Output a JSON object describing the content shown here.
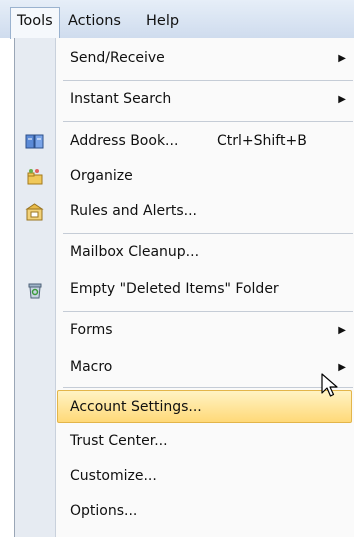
{
  "menubar": {
    "tools": "Tools",
    "actions": "Actions",
    "help": "Help"
  },
  "menu": {
    "send_receive": "Send/Receive",
    "instant_search": "Instant Search",
    "address_book": "Address Book...",
    "address_book_shortcut": "Ctrl+Shift+B",
    "organize": "Organize",
    "rules_and_alerts": "Rules and Alerts...",
    "mailbox_cleanup": "Mailbox Cleanup...",
    "empty_deleted": "Empty \"Deleted Items\" Folder",
    "forms": "Forms",
    "macro": "Macro",
    "account_settings": "Account Settings...",
    "trust_center": "Trust Center...",
    "customize": "Customize...",
    "options": "Options..."
  },
  "icons": {
    "address_book": "address-book-icon",
    "organize": "organize-icon",
    "rules_and_alerts": "rules-alerts-icon",
    "empty_deleted": "trash-can-icon",
    "submenu_arrow": "chevron-right-icon",
    "cursor": "mouse-pointer-icon"
  },
  "colors": {
    "highlight_top": "#fff3c4",
    "highlight_bottom": "#ffd978",
    "highlight_border": "#e3b54a",
    "menubar": "#dbe5f3",
    "icon_strip": "#e6ebf2"
  },
  "state": {
    "open_menu": "Tools",
    "hovered_item": "Account Settings..."
  }
}
